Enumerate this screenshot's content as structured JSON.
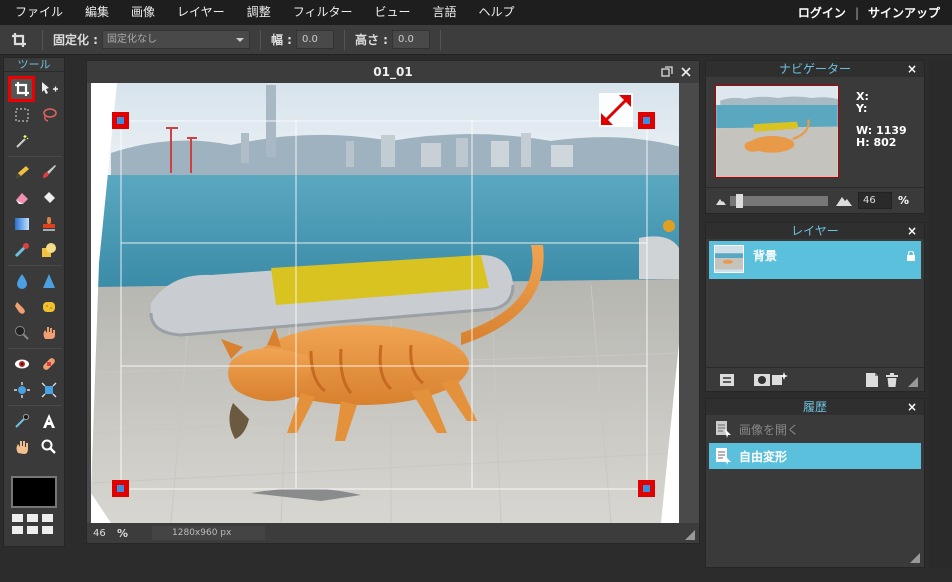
{
  "menubar": {
    "items": [
      "ファイル",
      "編集",
      "画像",
      "レイヤー",
      "調整",
      "フィルター",
      "ビュー",
      "言語",
      "ヘルプ"
    ],
    "login": "ログイン",
    "separator": "|",
    "signup": "サインアップ"
  },
  "optionbar": {
    "constrain_label": "固定化 :",
    "constrain_value": "固定化なし",
    "width_label": "幅 :",
    "width_value": "0.0",
    "height_label": "高さ :",
    "height_value": "0.0"
  },
  "tools": {
    "title": "ツール",
    "active": "crop-tool",
    "primary_color": "#000000"
  },
  "document": {
    "title": "01_01",
    "zoom": "46",
    "zoom_unit": "%",
    "dimensions": "1280x960 px"
  },
  "navigator": {
    "title": "ナビゲーター",
    "close": "×",
    "x_label": "X:",
    "y_label": "Y:",
    "w_label": "W:",
    "w_value": "1139",
    "h_label": "H:",
    "h_value": "802",
    "zoom_value": "46",
    "zoom_unit": "%"
  },
  "layers": {
    "title": "レイヤー",
    "close": "×",
    "items": [
      {
        "name": "背景",
        "locked": true
      }
    ]
  },
  "history": {
    "title": "履歴",
    "close": "×",
    "items": [
      "画像を開く",
      "自由変形"
    ]
  },
  "colors": {
    "accent": "#5bc0db",
    "panel_title": "#6fc0dc",
    "crop_handle": "#e00000"
  }
}
